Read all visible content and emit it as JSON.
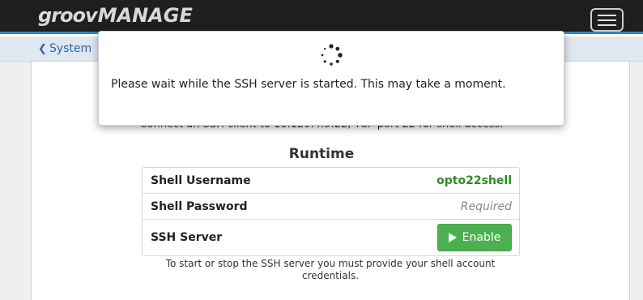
{
  "app": {
    "logo_primary": "groov",
    "logo_secondary": "MANAGE",
    "menu_icon": "hamburger-menu-icon"
  },
  "nav": {
    "back_icon": "chevron-left-icon",
    "back_label": "System"
  },
  "page": {
    "connect_hint": "Connect an SSH client to 10.129.4.9:22, TCP port 22 for shell access."
  },
  "runtime": {
    "title": "Runtime",
    "rows": [
      {
        "label": "Shell Username",
        "value": "opto22shell"
      },
      {
        "label": "Shell Password",
        "value": "Required"
      },
      {
        "label": "SSH Server",
        "button_label": "Enable",
        "button_icon": "play-icon"
      }
    ],
    "footnote": "To start or stop the SSH server you must provide your shell account credentials."
  },
  "modal": {
    "spinner_icon": "loading-spinner-icon",
    "message": "Please wait while the SSH server is started. This may take a moment."
  },
  "colors": {
    "topbar": "#1f1f1f",
    "accent_blue": "#2c86c7",
    "success_green": "#2e8b28",
    "button_green": "#4cb050"
  }
}
